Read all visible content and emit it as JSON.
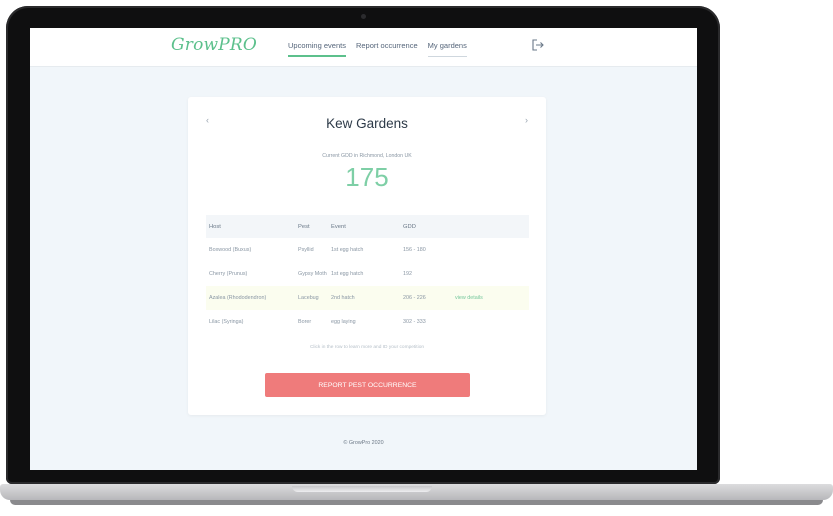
{
  "brand": {
    "logo_text": "GrowPRO",
    "accent_color": "#5cc08c"
  },
  "nav": {
    "links": [
      {
        "label": "Upcoming events",
        "active": true
      },
      {
        "label": "Report occurrence",
        "active": false
      },
      {
        "label": "My gardens",
        "active": false
      }
    ],
    "logout_icon": "logout-icon"
  },
  "card": {
    "title": "Kew Gardens",
    "prev_icon": "chevron-left-icon",
    "next_icon": "chevron-right-icon",
    "gdd_caption": "Current GDD in Richmond, London UK",
    "gdd_value": "175",
    "table": {
      "headers": [
        "Host",
        "Pest",
        "Event",
        "GDD"
      ],
      "rows": [
        {
          "host": "Boxwood (Buxus)",
          "pest": "Psyllid",
          "event": "1st egg hatch",
          "gdd": "156 - 180",
          "link": ""
        },
        {
          "host": "Cherry (Prunus)",
          "pest": "Gypsy Moth",
          "event": "1st egg hatch",
          "gdd": "192",
          "link": ""
        },
        {
          "host": "Azalea (Rhododendron)",
          "pest": "Lacebug",
          "event": "2nd hatch",
          "gdd": "206 - 226",
          "link": "view details"
        },
        {
          "host": "Lilac (Syringa)",
          "pest": "Borer",
          "event": "egg laying",
          "gdd": "302 - 333",
          "link": ""
        }
      ]
    },
    "hint": "Click in the row to learn more and ID your competition",
    "report_button": "REPORT PEST OCCURRENCE",
    "report_button_color": "#ef7b7b"
  },
  "footer": {
    "copyright": "© GrowPro 2020"
  }
}
